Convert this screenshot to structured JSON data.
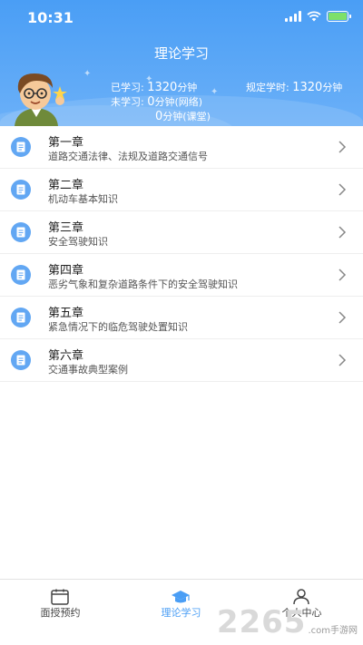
{
  "status_bar": {
    "time": "10:31"
  },
  "header": {
    "title": "理论学习",
    "studied_label": "已学习:",
    "studied_value": "1320",
    "studied_unit": "分钟",
    "required_label": "规定学时:",
    "required_value": "1320",
    "required_unit": "分钟",
    "unstudied_label": "未学习:",
    "unstudied_online_value": "0",
    "unstudied_online_unit": "分钟(网络)",
    "unstudied_class_value": "0",
    "unstudied_class_unit": "分钟(课堂)"
  },
  "chapters": [
    {
      "title": "第一章",
      "subtitle": "道路交通法律、法规及道路交通信号"
    },
    {
      "title": "第二章",
      "subtitle": "机动车基本知识"
    },
    {
      "title": "第三章",
      "subtitle": "安全驾驶知识"
    },
    {
      "title": "第四章",
      "subtitle": "恶劣气象和复杂道路条件下的安全驾驶知识"
    },
    {
      "title": "第五章",
      "subtitle": "紧急情况下的临危驾驶处置知识"
    },
    {
      "title": "第六章",
      "subtitle": "交通事故典型案例"
    }
  ],
  "tabbar": {
    "tabs": [
      {
        "label": "面授预约",
        "icon": "calendar-icon"
      },
      {
        "label": "理论学习",
        "icon": "graduation-cap-icon",
        "active": true
      },
      {
        "label": "个人中心",
        "icon": "user-icon"
      }
    ],
    "active_color": "#4a9ef5"
  },
  "watermark": {
    "text": "2265",
    "suffix": ".com手游网"
  },
  "colors": {
    "header": "#4a9ef5",
    "chapter_icon": "#62a7f3"
  }
}
